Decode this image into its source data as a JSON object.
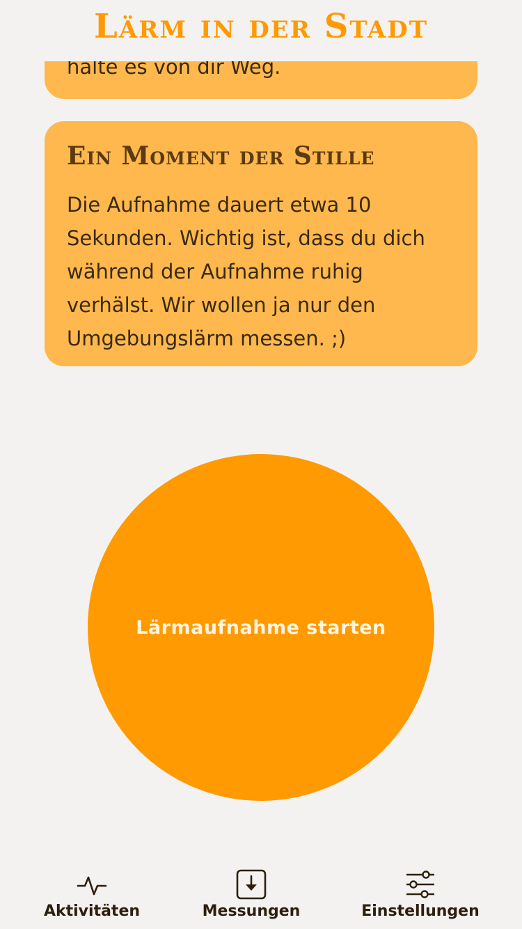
{
  "app": {
    "title": "Lärm in der Stadt"
  },
  "cards": {
    "previous_text": "halte es von dir Weg.",
    "moment": {
      "heading": "Ein Moment der Stille",
      "text": "Die Aufnahme dauert etwa 10 Sekunden. Wichtig ist, dass du dich während der Aufnahme ruhig verhälst. Wir wollen ja nur den Umgebungslärm messen. ;)"
    }
  },
  "record": {
    "label": "Lärmaufnahme starten"
  },
  "nav": {
    "items": [
      {
        "label": "Aktivitäten",
        "icon": "activity-icon"
      },
      {
        "label": "Messungen",
        "icon": "download-icon"
      },
      {
        "label": "Einstellungen",
        "icon": "sliders-icon"
      }
    ]
  },
  "colors": {
    "accent": "#ff9a02",
    "card": "#ffb84d",
    "background": "#f4f2f1",
    "heading": "#5a3a10"
  }
}
